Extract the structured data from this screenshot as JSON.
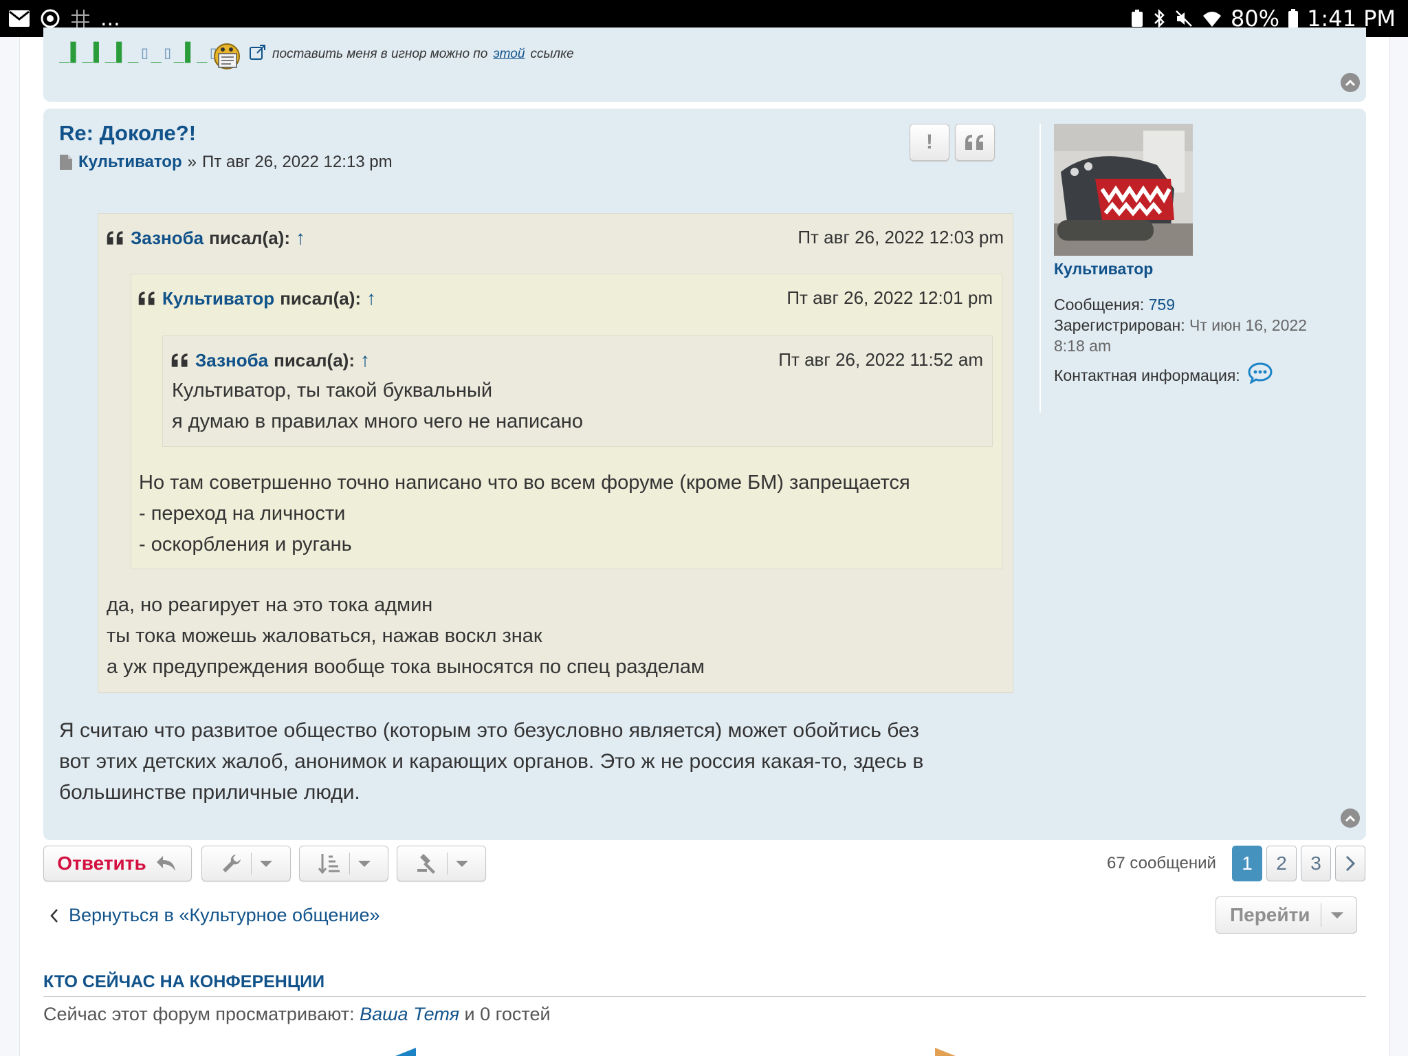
{
  "status_bar": {
    "left_extra": "...",
    "battery": "80%",
    "time": "1:41 PM"
  },
  "prev_post": {
    "sig_text_before": "поставить меня в игнор можно по",
    "sig_link": "этой",
    "sig_text_after": "ссылке"
  },
  "post": {
    "title": "Re: Доколе?!",
    "author": "Культиватор",
    "separator": "»",
    "date": "Пт авг 26, 2022 12:13 pm",
    "quote1": {
      "author": "Зазноба",
      "wrote": "писал(а):",
      "date": "Пт авг 26, 2022 12:03 pm",
      "lines": [
        "да, но реагирует на это тока админ",
        "ты тока можешь жаловаться, нажав воскл знак",
        "а уж предупреждения вообще тока выносятся по спец разделам"
      ]
    },
    "quote2": {
      "author": "Культиватор",
      "wrote": "писал(а):",
      "date": "Пт авг 26, 2022 12:01 pm",
      "lines": [
        "Но там советршенно точно написано что во всем форуме (кроме БМ) запрещается",
        "- переход на личности",
        "- оскорбления и ругань"
      ]
    },
    "quote3": {
      "author": "Зазноба",
      "wrote": "писал(а):",
      "date": "Пт авг 26, 2022 11:52 am",
      "lines": [
        "Культиватор, ты такой буквальный",
        "я думаю в правилах много чего не написано"
      ]
    },
    "body_lines": [
      "Я считаю что развитое общество (которым это безусловно является) может обойтись без",
      "вот этих детских жалоб, анонимок и карающих органов. Это ж не россия какая-то, здесь в",
      "большинстве приличные люди."
    ]
  },
  "profile": {
    "name": "Культиватор",
    "posts_label": "Сообщения:",
    "posts_value": "759",
    "registered_label": "Зарегистрирован:",
    "registered_value_1": "Чт июн 16, 2022",
    "registered_value_2": "8:18 am",
    "contact_label": "Контактная информация:"
  },
  "actions": {
    "reply_label": "Ответить",
    "post_count": "67 сообщений",
    "pages": [
      "1",
      "2",
      "3"
    ],
    "current_page": "1",
    "back_link": "Вернуться в «Культурное общение»",
    "jump_label": "Перейти"
  },
  "who_online": {
    "title": "КТО СЕЙЧАС НА КОНФЕРЕНЦИИ",
    "text_before": "Сейчас этот форум просматривают:",
    "user": "Ваша Тетя",
    "text_after": "и 0 гостей"
  },
  "colors": {
    "link": "#105289",
    "post_bg": "#e1ebf2",
    "reply_red": "#d31141",
    "page_active": "#4692bf"
  }
}
